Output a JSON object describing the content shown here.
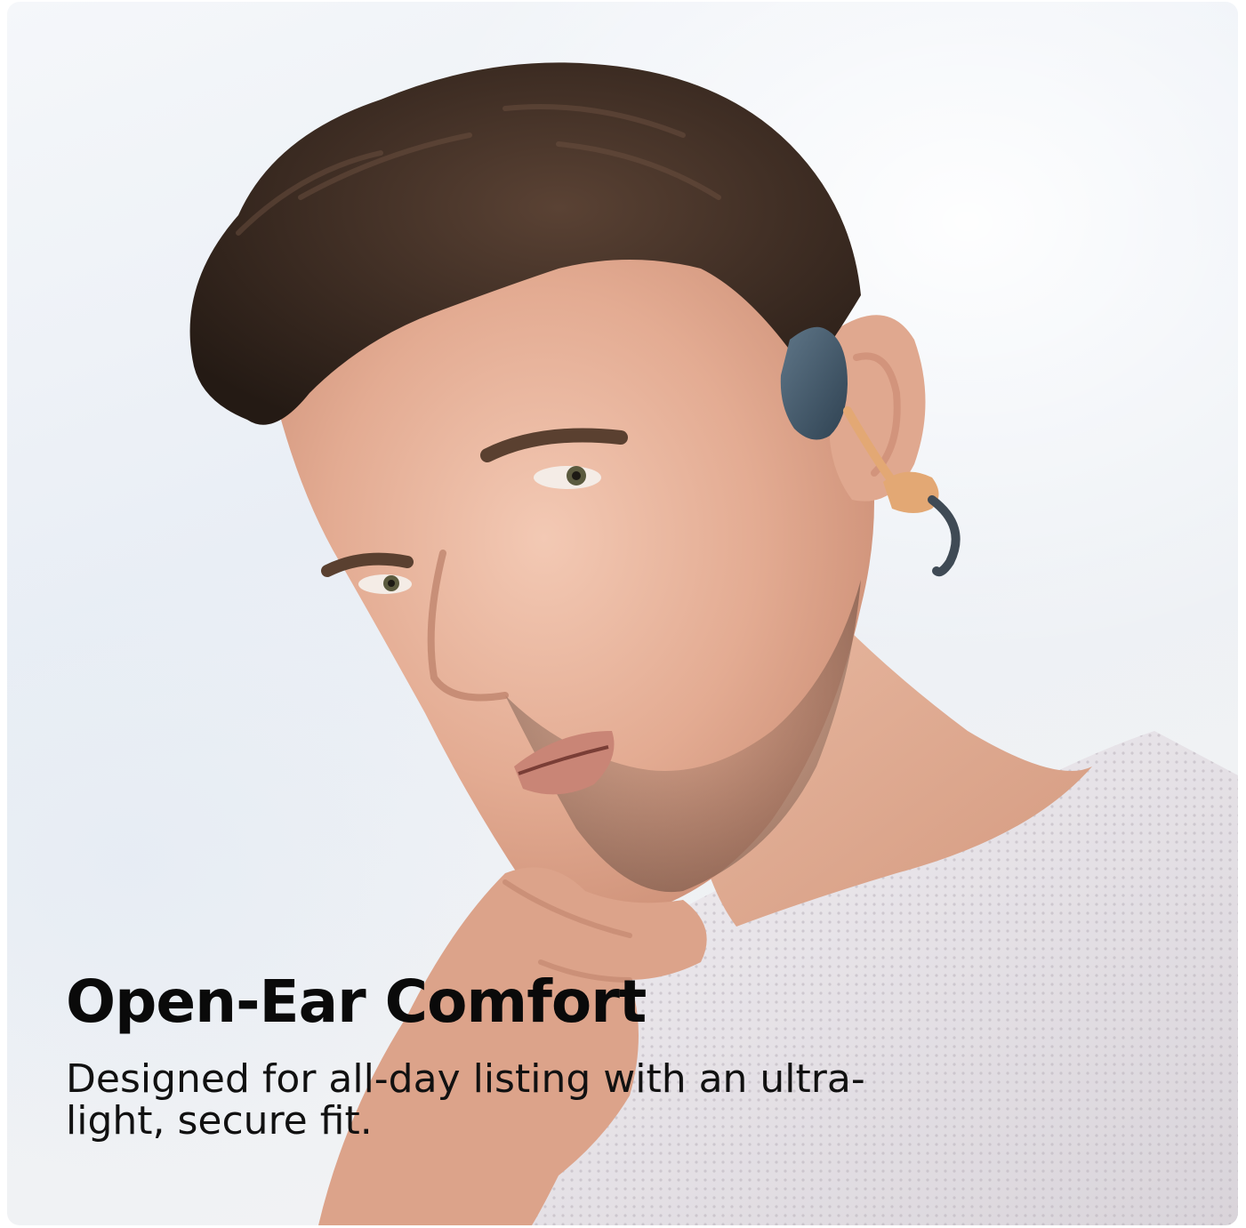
{
  "headline": "Open-Ear Comfort",
  "subline": "Designed for all-day listing with an ultra-light, secure fit.",
  "colors": {
    "text": "#0a0a0a",
    "sky": "#eef1f5",
    "skin": "#e8b49c",
    "hair": "#3b2a22",
    "shirt": "#e6e2e6",
    "earphone": "#3f5566",
    "earphone_accent": "#e3a874"
  }
}
